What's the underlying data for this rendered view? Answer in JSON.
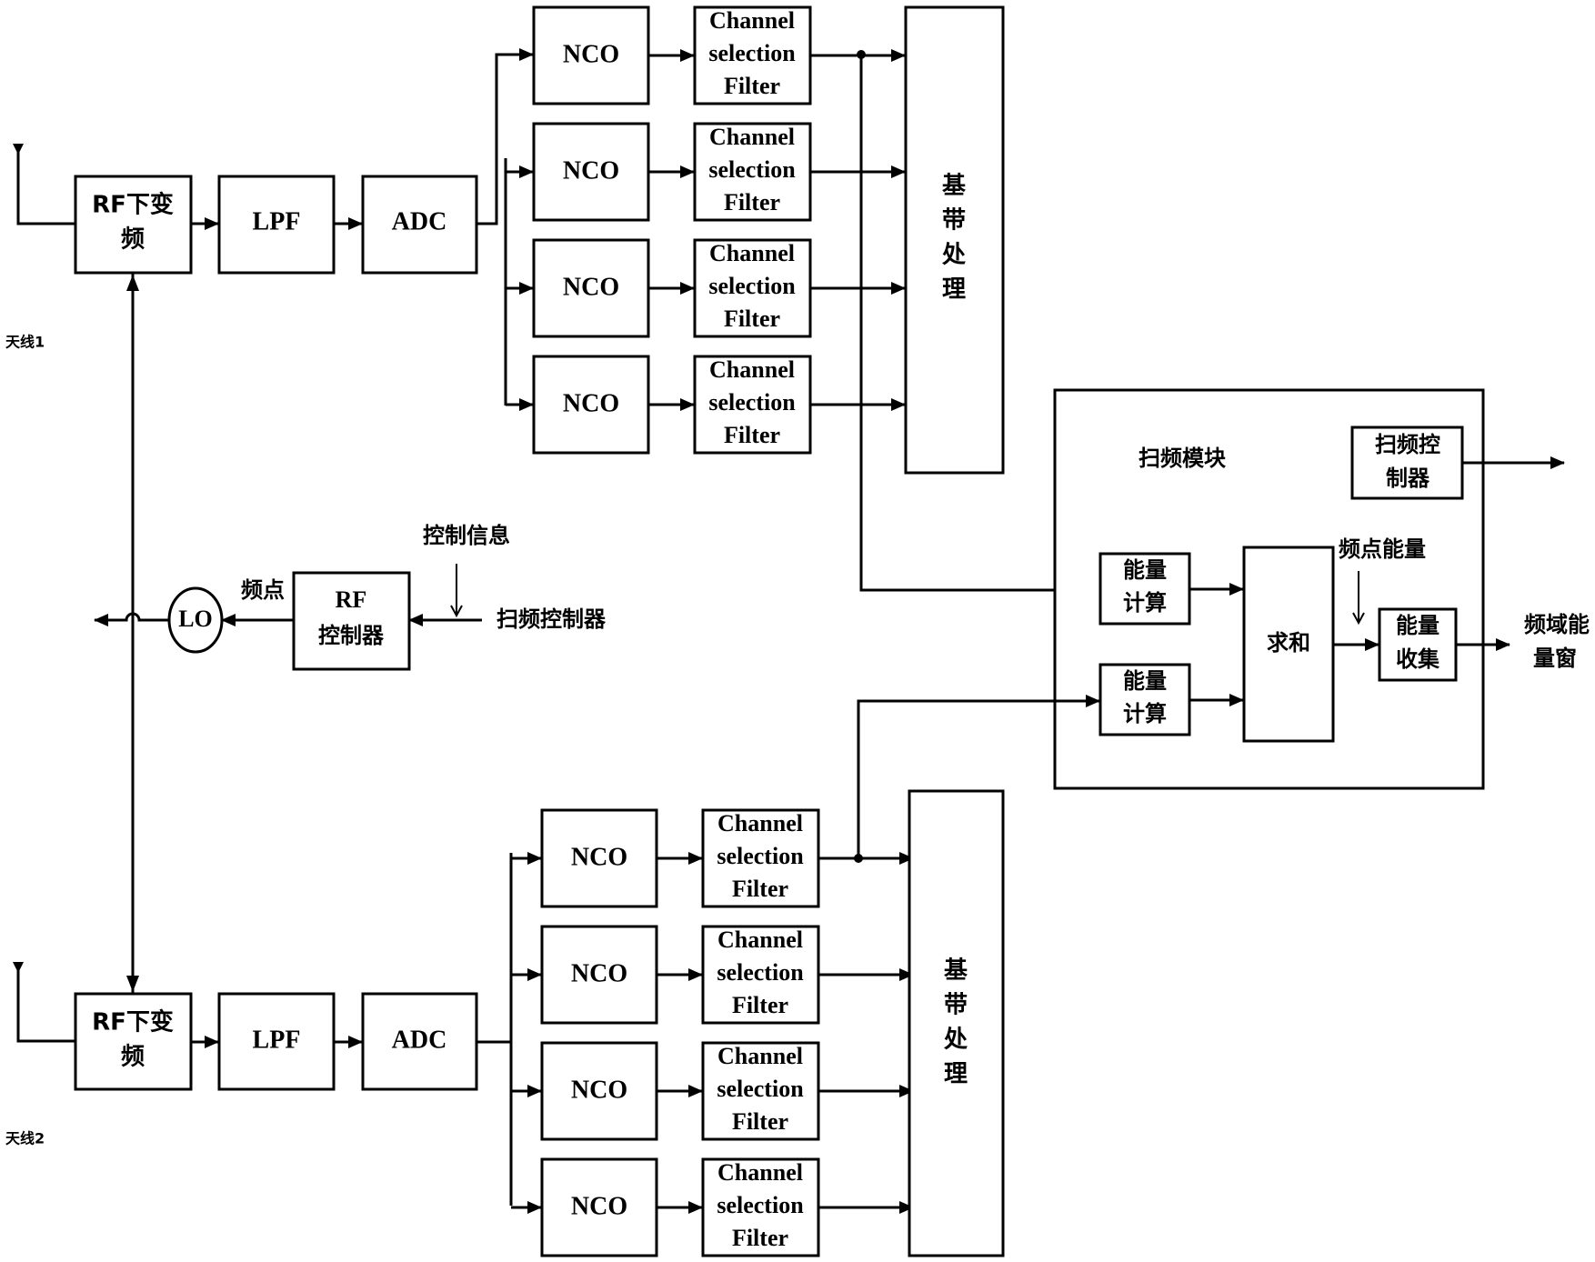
{
  "diagram": {
    "antenna1": {
      "label": "天线1"
    },
    "antenna2": {
      "label": "天线2"
    },
    "chain1": {
      "rf": [
        "RF下变",
        "频"
      ],
      "lpf": "LPF",
      "adc": "ADC"
    },
    "chain2": {
      "rf": [
        "RF下变",
        "频"
      ],
      "lpf": "LPF",
      "adc": "ADC"
    },
    "nco_label": "NCO",
    "filter_label": [
      "Channel",
      "selection",
      "Filter"
    ],
    "branch_count": 4,
    "baseband": [
      "基",
      "带",
      "处",
      "理"
    ],
    "lo": {
      "label": "LO",
      "freq_label": "频点"
    },
    "rf_controller": {
      "label": [
        "RF",
        "控制器"
      ],
      "control_info": "控制信息",
      "sweep_controller_input": "扫频控制器"
    },
    "sweep_module": {
      "title": "扫频模块",
      "sweep_controller": [
        "扫频控",
        "制器"
      ],
      "energy_calc": [
        "能量",
        "计算"
      ],
      "sum": "求和",
      "freq_energy": "频点能量",
      "energy_collect": [
        "能量",
        "收集"
      ],
      "output": [
        "频域能",
        "量窗"
      ]
    }
  }
}
